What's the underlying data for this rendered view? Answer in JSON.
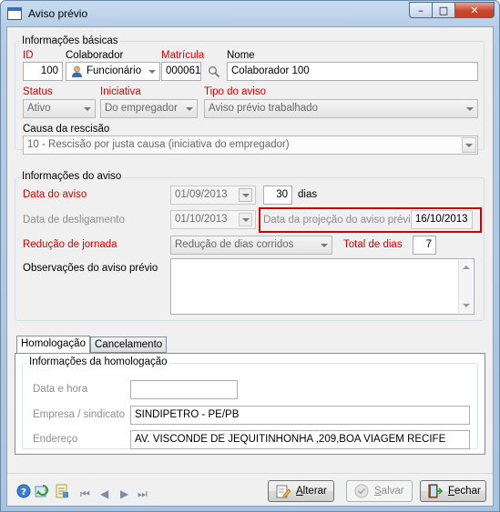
{
  "window": {
    "title": "Aviso prévio",
    "minimize_glyph": "–",
    "maximize_glyph": "□",
    "close_glyph": "✕"
  },
  "info_basicas": {
    "title": "Informações básicas",
    "id_label": "ID",
    "id_value": "100",
    "colaborador_label": "Colaborador",
    "colaborador_value": "Funcionário",
    "matricula_label": "Matrícula",
    "matricula_value": "000061",
    "nome_label": "Nome",
    "nome_value": "Colaborador 100",
    "status_label": "Status",
    "status_value": "Ativo",
    "iniciativa_label": "Iniciativa",
    "iniciativa_value": "Do empregador",
    "tipo_label": "Tipo do aviso",
    "tipo_value": "Aviso prévio trabalhado",
    "causa_label": "Causa da rescisão",
    "causa_value": "10 - Rescisão por justa causa (iniciativa do empregador)"
  },
  "info_aviso": {
    "title": "Informações do aviso",
    "data_aviso_label": "Data do aviso",
    "data_aviso_value": "01/09/2013",
    "dias_value": "30",
    "dias_label": "dias",
    "desligamento_label": "Data de desligamento",
    "desligamento_value": "01/10/2013",
    "projecao_label": "Data da projeção do aviso prévio",
    "projecao_value": "16/10/2013",
    "reducao_label": "Redução de jornada",
    "reducao_value": "Redução de dias corridos",
    "total_label": "Total de dias",
    "total_value": "7",
    "obs_label": "Observações do aviso prévio",
    "obs_value": ""
  },
  "tabs": {
    "homologacao": "Homologação",
    "cancelamento": "Cancelamento"
  },
  "homologacao": {
    "title": "Informações da homologação",
    "data_hora_label": "Data e hora",
    "data_hora_value": "",
    "empresa_label": "Empresa / sindicato",
    "empresa_value": "SINDIPETRO - PE/PB",
    "endereco_label": "Endereço",
    "endereco_value": "AV. VISCONDE DE JEQUITINHONHA ,209,BOA VIAGEM RECIFE"
  },
  "footer": {
    "help_icon": "help-icon",
    "refresh_icon": "refresh-icon",
    "report_icon": "report-icon",
    "nav_first": "⏮",
    "nav_prev": "◀",
    "nav_next": "▶",
    "nav_last": "⏭",
    "alterar": "Alterar",
    "salvar": "Salvar",
    "fechar": "Fechar"
  },
  "colors": {
    "required_label": "#d40000",
    "highlight_border": "#d40000",
    "window_frame": "#b5cde6"
  }
}
